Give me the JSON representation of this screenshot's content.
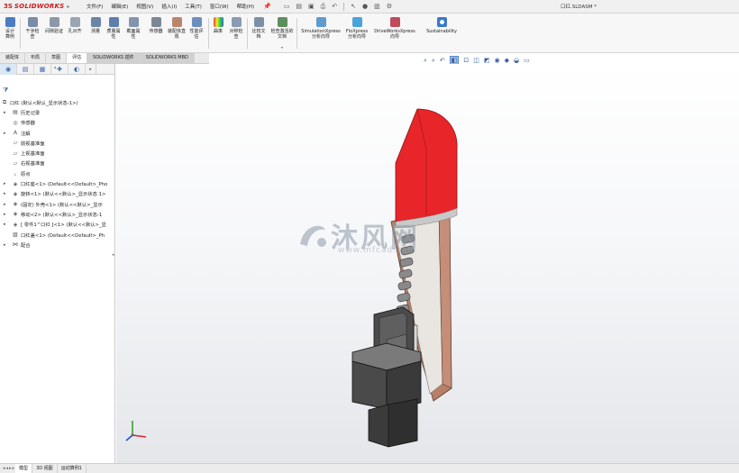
{
  "app": {
    "logo_ds": "3S",
    "logo_name": "SOLIDWORKS",
    "document_title": "口红.SLDASM *"
  },
  "menu": [
    "文件(F)",
    "编辑(E)",
    "视图(V)",
    "插入(I)",
    "工具(T)",
    "窗口(W)",
    "帮助(H)"
  ],
  "ribbon": {
    "buttons": [
      {
        "label": "设计算例",
        "icon": "design-study-icon"
      },
      {
        "label": "干涉检查",
        "icon": "interference-icon"
      },
      {
        "label": "间隙验证",
        "icon": "clearance-icon"
      },
      {
        "label": "孔对齐",
        "icon": "hole-align-icon"
      },
      {
        "label": "测量",
        "icon": "measure-icon"
      },
      {
        "label": "质量属性",
        "icon": "mass-props-icon"
      },
      {
        "label": "截面属性",
        "icon": "section-props-icon"
      },
      {
        "label": "传感器",
        "icon": "sensor-icon"
      },
      {
        "label": "装配体直观",
        "icon": "assembly-visual-icon"
      },
      {
        "label": "性能评估",
        "icon": "performance-icon"
      },
      {
        "label": "曲率",
        "icon": "curvature-icon"
      },
      {
        "label": "对称检查",
        "icon": "symmetry-icon"
      },
      {
        "label": "比较文档",
        "icon": "compare-icon"
      },
      {
        "label": "检查激活的文档",
        "icon": "check-doc-icon"
      },
      {
        "label": "SimulationXpress 分析向导",
        "icon": "simulation-icon"
      },
      {
        "label": "FloXpress 分析向导",
        "icon": "floxpress-icon"
      },
      {
        "label": "DriveWorksXpress 向导",
        "icon": "driveworks-icon"
      },
      {
        "label": "Sustainability",
        "icon": "sustainability-icon"
      }
    ]
  },
  "command_tabs": [
    "装配体",
    "布局",
    "草图",
    "评估",
    "SOLIDWORKS 插件",
    "SOLIDWORKS MBD"
  ],
  "active_command_tab": "评估",
  "feature_tree": [
    {
      "label": "口红  (默认<默认_显示状态-1>)",
      "icon": "assembly-icon",
      "expand": ""
    },
    {
      "label": "历史记录",
      "icon": "history-icon",
      "expand": "▸"
    },
    {
      "label": "传感器",
      "icon": "sensor-icon",
      "expand": ""
    },
    {
      "label": "注解",
      "icon": "annotation-icon",
      "expand": "▸"
    },
    {
      "label": "前视基准面",
      "icon": "plane-icon",
      "expand": ""
    },
    {
      "label": "上视基准面",
      "icon": "plane-icon",
      "expand": ""
    },
    {
      "label": "右视基准面",
      "icon": "plane-icon",
      "expand": ""
    },
    {
      "label": "原点",
      "icon": "origin-icon",
      "expand": ""
    },
    {
      "label": "口红座<1> (Default<<Default>_Pho",
      "icon": "part-icon",
      "expand": "▸"
    },
    {
      "label": "旋转<1> (默认<<默认>_显示状态 1>",
      "icon": "part-icon",
      "expand": "▸"
    },
    {
      "label": "(固定) 外壳<1> (默认<<默认>_显示",
      "icon": "part-icon",
      "expand": "▸"
    },
    {
      "label": "移动<2> (默认<<默认>_显示状态-1",
      "icon": "part-icon",
      "expand": "▸"
    },
    {
      "label": "[ 零件1^口红 ]<1> (默认<<默认>_显",
      "icon": "part-icon",
      "expand": "▸"
    },
    {
      "label": "口红盖<1> (Default<<Default>_Ph",
      "icon": "part-suppressed-icon",
      "expand": ""
    },
    {
      "label": "配合",
      "icon": "mates-icon",
      "expand": "▸"
    }
  ],
  "watermark": {
    "text": "沐风网",
    "url": "www.mfcad.com"
  },
  "bottom_tabs": [
    "模型",
    "3D 视图",
    "运动算例1"
  ],
  "active_bottom_tab": "模型",
  "colors": {
    "lipstick": "#e8262a",
    "case_dark": "#3d3d3d",
    "shell_copper": "#b27f6a",
    "spring": "#8a8a8a",
    "brand_red": "#cc1b1b"
  }
}
